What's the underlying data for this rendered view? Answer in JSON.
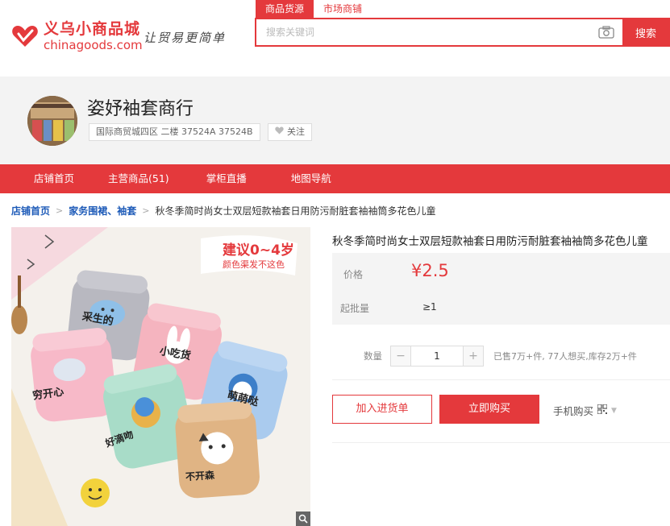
{
  "site": {
    "logo_cn": "义乌小商品城",
    "logo_en": "chinagoods.com",
    "slogan": "让贸易更简单"
  },
  "search": {
    "tabs": [
      "商品货源",
      "市场商铺"
    ],
    "active_tab": 0,
    "placeholder": "搜索关键词",
    "button_label": "搜索"
  },
  "shop": {
    "name": "姿妤袖套商行",
    "address": "国际商贸城四区 二楼 37524A 37524B",
    "follow_label": "关注"
  },
  "nav": {
    "items": [
      "店铺首页",
      "主营商品(51)",
      "掌柜直播",
      "地图导航"
    ]
  },
  "breadcrumb": {
    "home": "店铺首页",
    "category": "家务围裙、袖套",
    "current": "秋冬季简时尚女士双层短款袖套日用防污耐脏套袖袖筒多花色儿童"
  },
  "product": {
    "title": "秋冬季简时尚女士双层短款袖套日用防污耐脏套袖袖筒多花色儿童",
    "price_label": "价格",
    "price": "¥2.5",
    "moq_label": "起批量",
    "moq": "≥1",
    "qty_label": "数量",
    "qty_value": "1",
    "stock_info": "已售7万+件, 77人想买,库存2万+件",
    "add_cart_label": "加入进货单",
    "buy_label": "立即购买",
    "mobile_buy_label": "手机购买",
    "image_text": {
      "banner_line1": "建议0~4岁",
      "banner_line2": "颜色渠发不这色",
      "sleeve_labels": [
        "采生的",
        "小吃货",
        "穷开心",
        "萌萌哒",
        "好滴吻",
        "不开森"
      ]
    }
  },
  "colors": {
    "brand_red": "#e4393c",
    "link_blue": "#1e5bb8"
  }
}
